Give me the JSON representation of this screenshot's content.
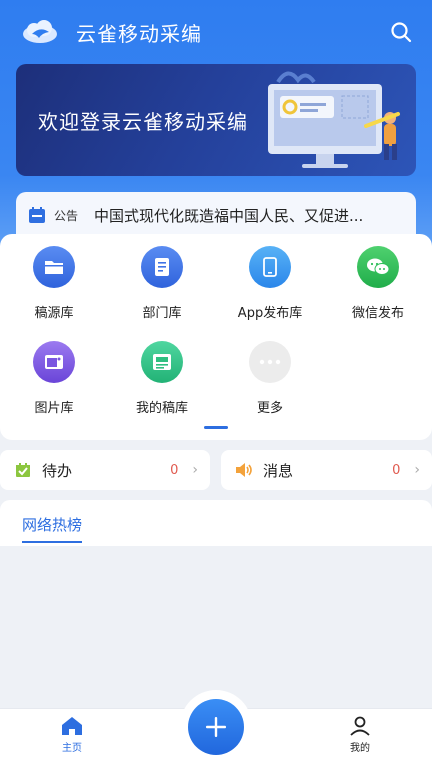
{
  "header": {
    "title": "云雀移动采编",
    "logo_icon": "cloud-bird-logo",
    "search_icon": "search-icon"
  },
  "banner": {
    "title": "欢迎登录云雀移动采编"
  },
  "notice": {
    "label": "公告",
    "text": "中国式现代化既造福中国人民、又促进..."
  },
  "grid": {
    "items": [
      {
        "label": "稿源库",
        "icon": "folder-icon",
        "color": "#3f73e6"
      },
      {
        "label": "部门库",
        "icon": "document-icon",
        "color": "#3f73e6"
      },
      {
        "label": "App发布库",
        "icon": "phone-icon",
        "color": "#3b9cf0"
      },
      {
        "label": "微信发布",
        "icon": "wechat-icon",
        "color": "#2fbf5a"
      },
      {
        "label": "图片库",
        "icon": "image-icon",
        "color": "#7a56e0"
      },
      {
        "label": "我的稿库",
        "icon": "manuscript-icon",
        "color": "#2fbf80"
      },
      {
        "label": "更多",
        "icon": "more-icon",
        "color": "#e8e8e8"
      }
    ]
  },
  "status": {
    "todo": {
      "label": "待办",
      "count": "0",
      "icon": "todo-icon"
    },
    "message": {
      "label": "消息",
      "count": "0",
      "icon": "speaker-icon"
    }
  },
  "hot": {
    "tab_label": "网络热榜"
  },
  "bottom_nav": {
    "home": {
      "label": "主页",
      "icon": "home-icon"
    },
    "add": {
      "icon": "plus-icon"
    },
    "mine": {
      "label": "我的",
      "icon": "user-icon"
    }
  },
  "colors": {
    "primary": "#2f7df0",
    "accent_red": "#e05a4f"
  }
}
